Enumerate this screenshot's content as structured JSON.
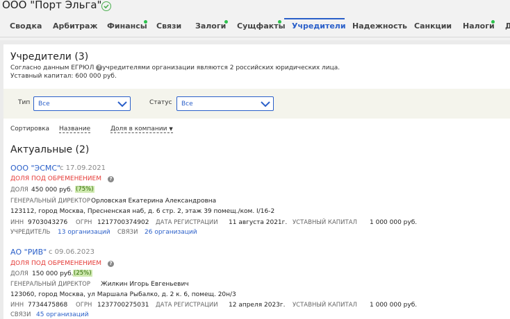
{
  "company": {
    "title": "ООО \"Порт Эльга\""
  },
  "tabs": [
    {
      "label": "Сводка"
    },
    {
      "label": "Арбитраж"
    },
    {
      "label": "Финансы"
    },
    {
      "label": "Связи"
    },
    {
      "label": "Залоги"
    },
    {
      "label": "Сущфакты"
    },
    {
      "label": "Учредители"
    },
    {
      "label": "Надежность"
    },
    {
      "label": "Санкции"
    },
    {
      "label": "Налоги"
    },
    {
      "label": "Д"
    }
  ],
  "founders": {
    "title": "Учредители (3)",
    "desc_part1": "Согласно данным ЕГРЮЛ",
    "desc_part2": "учредителями организации являются 2 российских юридических лица.",
    "capital": "Уставный капитал: 600 000 руб."
  },
  "filters": {
    "type_label": "Тип",
    "type_value": "Все",
    "status_label": "Статус",
    "status_value": "Все"
  },
  "sort": {
    "label": "Сортировка",
    "by_name": "Название",
    "by_share": "Доля в компании"
  },
  "actual": {
    "title": "Актуальные (2)"
  },
  "entries": [
    {
      "name": "ООО \"ЭСМС\"",
      "since": "с 17.09.2021",
      "encumbrance": "ДОЛЯ ПОД ОБРЕМЕНЕНИЕМ",
      "share_label": "ДОЛЯ",
      "share_value": "450 000 руб.",
      "share_pct": "(75%)",
      "director_label": "ГЕНЕРАЛЬНЫЙ ДИРЕКТОР",
      "director": "Орловская Екатерина Александровна",
      "address": "123112, город Москва, Пресненская наб, д. 6 стр. 2, этаж 39 помещ./ком. I/16-2",
      "inn_label": "ИНН",
      "inn": "9703043276",
      "ogrn_label": "ОГРН",
      "ogrn": "1217700374902",
      "reg_label": "ДАТА РЕГИСТРАЦИИ",
      "reg": "11 августа 2021г.",
      "cap_label": "УСТАВНЫЙ КАПИТАЛ",
      "cap": "1 000 000 руб.",
      "founder_label": "УЧРЕДИТЕЛЬ",
      "founder_link": "13 организаций",
      "links_label": "СВЯЗИ",
      "links_link": "26 организаций"
    },
    {
      "name": "АО \"РИВ\"",
      "since": "с 09.06.2023",
      "encumbrance": "ДОЛЯ ПОД ОБРЕМЕНЕНИЕМ",
      "share_label": "ДОЛЯ",
      "share_value": "150 000 руб.",
      "share_pct": "(25%)",
      "director_label": "ГЕНЕРАЛЬНЫЙ ДИРЕКТОР",
      "director": "Жилкин Игорь Евгеньевич",
      "address": "123060, город Москва, ул Маршала Рыбалко, д. 2 к. 6, помещ. 20н/3",
      "inn_label": "ИНН",
      "inn": "7734475868",
      "ogrn_label": "ОГРН",
      "ogrn": "1237700275031",
      "reg_label": "ДАТА РЕГИСТРАЦИИ",
      "reg": "12 апреля 2023г.",
      "cap_label": "УСТАВНЫЙ КАПИТАЛ",
      "cap": "1 000 000 руб.",
      "links_label": "СВЯЗИ",
      "links_link": "45 организаций"
    }
  ]
}
